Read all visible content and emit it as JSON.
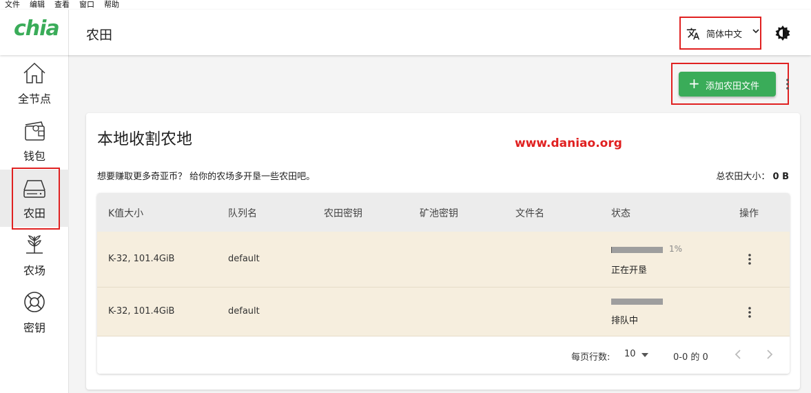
{
  "menubar": {
    "items": [
      "文件",
      "编辑",
      "查看",
      "窗口",
      "帮助"
    ]
  },
  "header": {
    "logo": "chia",
    "title": "农田",
    "language": "简体中文"
  },
  "sidebar": {
    "items": [
      {
        "label": "全节点",
        "icon": "home-icon"
      },
      {
        "label": "钱包",
        "icon": "wallet-icon"
      },
      {
        "label": "农田",
        "icon": "hard-drive-icon",
        "active": true
      },
      {
        "label": "农场",
        "icon": "plant-icon"
      },
      {
        "label": "密钥",
        "icon": "lifebuoy-icon"
      }
    ]
  },
  "toolbar": {
    "add_button": "添加农田文件"
  },
  "card": {
    "title": "本地收割农地",
    "watermark": "www.daniao.org",
    "description": "想要赚取更多奇亚币？ 给你的农场多开垦一些农田吧。",
    "size_label": "总农田大小：",
    "size_value": "0 B"
  },
  "table": {
    "headers": [
      "K值大小",
      "队列名",
      "农田密钥",
      "矿池密钥",
      "文件名",
      "状态",
      "操作"
    ],
    "rows": [
      {
        "k_size": "K-32, 101.4GiB",
        "queue": "default",
        "progress": 0.01,
        "progress_label": "1%",
        "status": "正在开垦"
      },
      {
        "k_size": "K-32, 101.4GiB",
        "queue": "default",
        "progress": 0,
        "progress_label": "",
        "status": "排队中"
      }
    ]
  },
  "pagination": {
    "rows_per_page_label": "每页行数:",
    "rows_per_page": "10",
    "range": "0-0 的 0"
  },
  "colors": {
    "accent": "#3aac59",
    "highlight": "#e02020",
    "row_bg": "#f6eede"
  }
}
